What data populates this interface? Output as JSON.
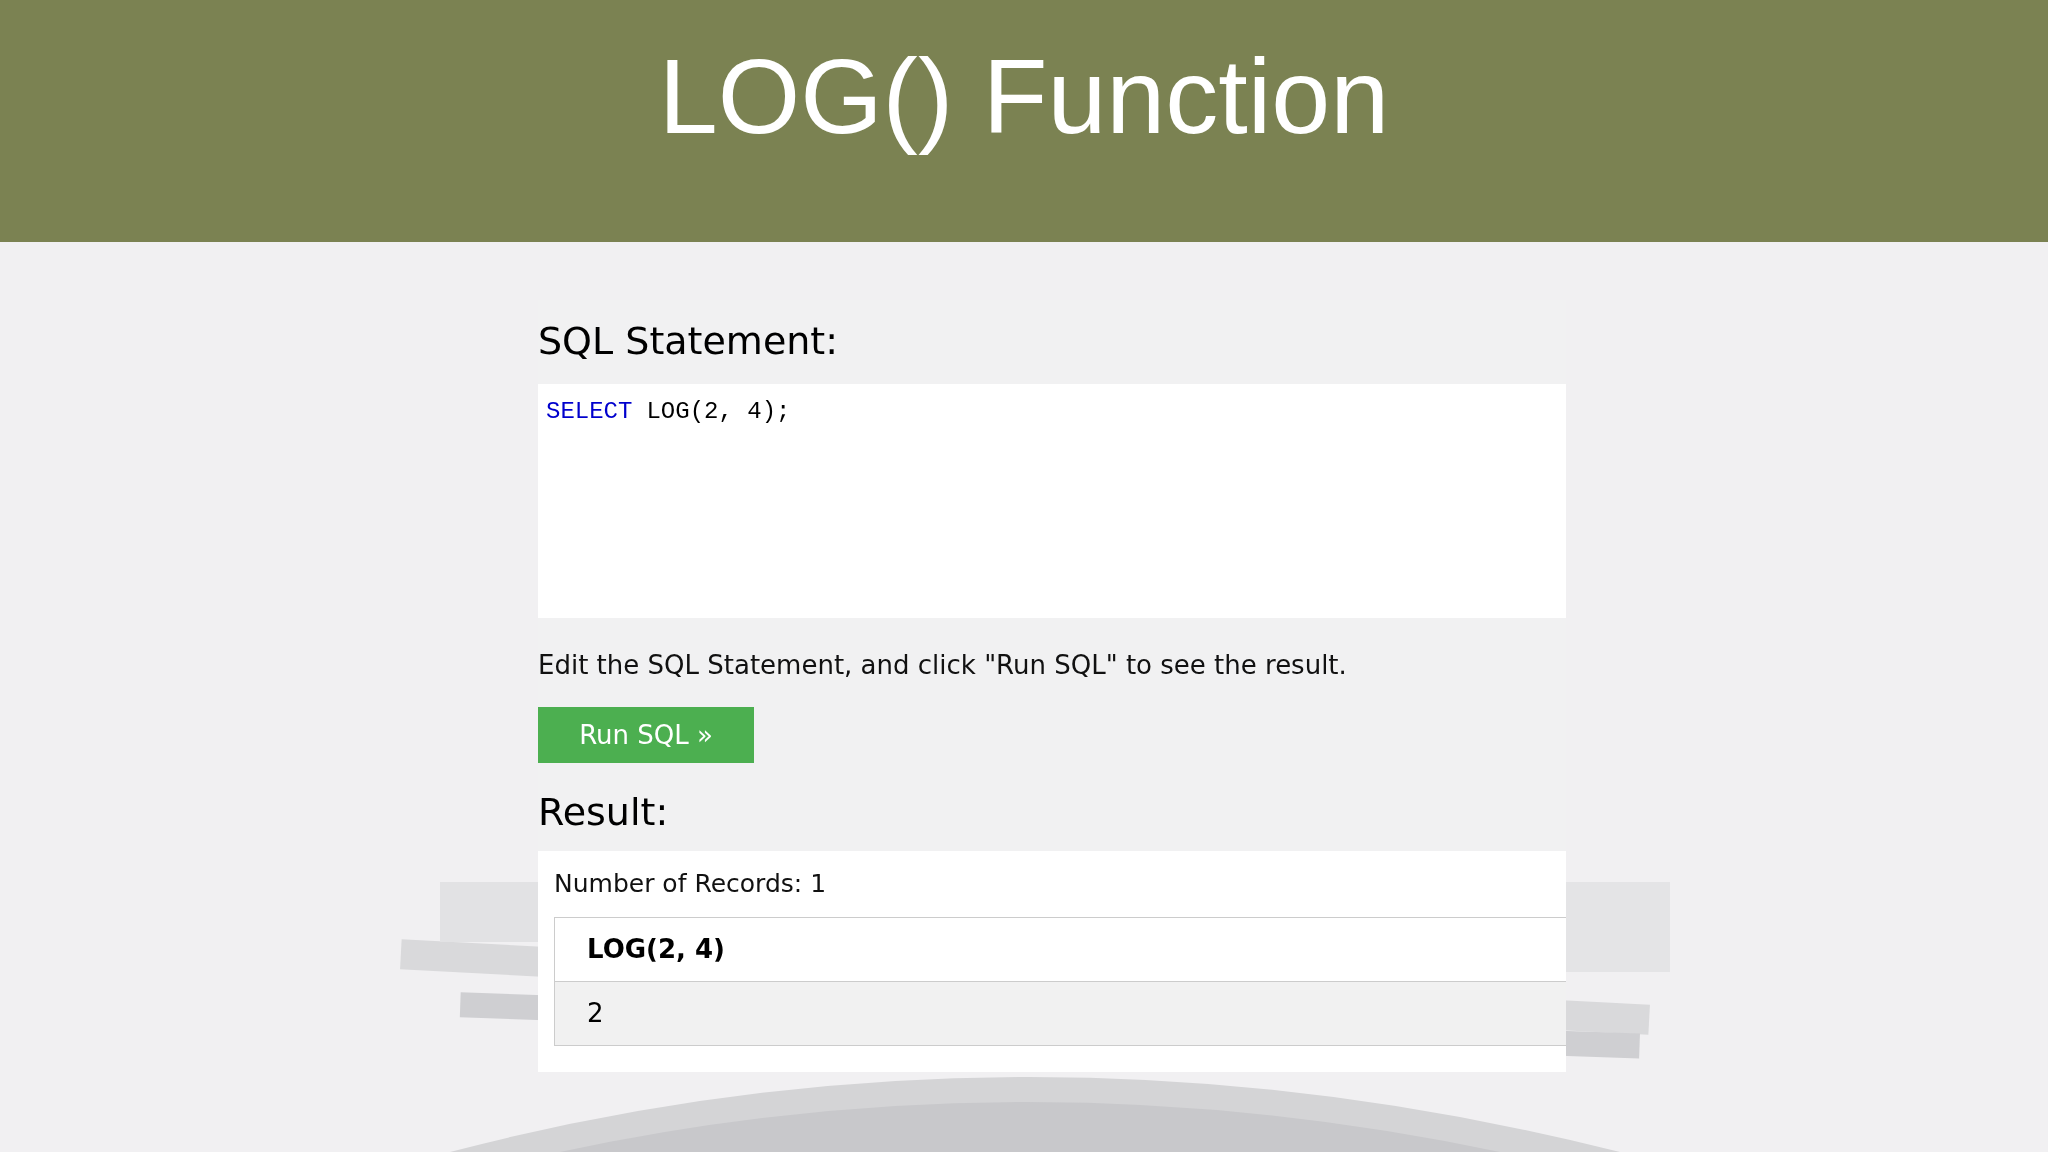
{
  "slide_title": "LOG() Function",
  "editor": {
    "heading": "SQL Statement:",
    "code_tokens": [
      {
        "text": "SELECT",
        "kind": "keyword"
      },
      {
        "text": "LOG(2, 4);",
        "kind": "plain"
      }
    ]
  },
  "instruction": "Edit the SQL Statement, and click \"Run SQL\" to see the result.",
  "run_button": "Run SQL »",
  "result": {
    "heading": "Result:",
    "record_count": "Number of Records: 1",
    "table": {
      "columns": [
        "LOG(2, 4)"
      ],
      "rows": [
        [
          "2"
        ]
      ]
    }
  }
}
